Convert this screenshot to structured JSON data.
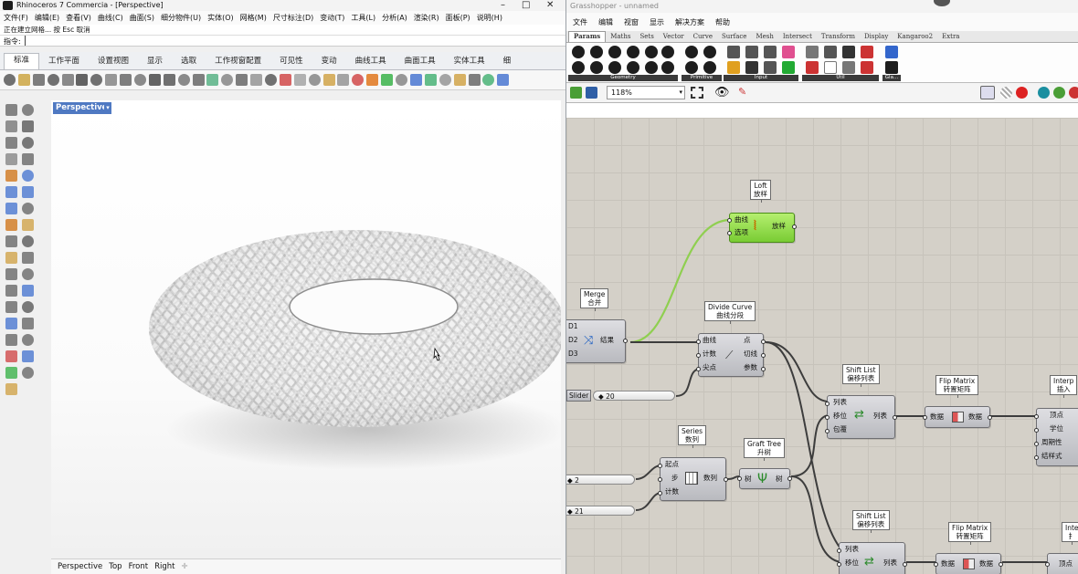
{
  "rhino": {
    "title": "Rhinoceros 7 Commercia - [Perspective]",
    "menu": [
      "文件(F)",
      "编辑(E)",
      "查看(V)",
      "曲线(C)",
      "曲面(S)",
      "细分物件(U)",
      "实体(O)",
      "网格(M)",
      "尺寸标注(D)",
      "变动(T)",
      "工具(L)",
      "分析(A)",
      "渲染(R)",
      "面板(P)",
      "说明(H)"
    ],
    "history_line": "正在建立网格... 按 Esc 取消",
    "command_label": "指令:",
    "tabs": [
      "标准",
      "工作平面",
      "设置视图",
      "显示",
      "选取",
      "工作视窗配置",
      "可见性",
      "变动",
      "曲线工具",
      "曲面工具",
      "实体工具",
      "细"
    ],
    "viewport_label": "Perspective",
    "viewport_tabs": [
      "Perspective",
      "Top",
      "Front",
      "Right"
    ],
    "add_view": "✛"
  },
  "gh": {
    "title": "Grasshopper - unnamed",
    "menu": [
      "文件",
      "编辑",
      "视窗",
      "显示",
      "解决方案",
      "帮助"
    ],
    "tabs": [
      "Params",
      "Maths",
      "Sets",
      "Vector",
      "Curve",
      "Surface",
      "Mesh",
      "Intersect",
      "Transform",
      "Display",
      "Kangaroo2",
      "Extra"
    ],
    "ribbon_groups": [
      "Geometry",
      "Primitive",
      "Input",
      "Util",
      "Gla..."
    ],
    "zoom": "118%",
    "nodes": {
      "loft": {
        "tag1": "Loft",
        "tag2": "放样",
        "in": [
          "曲线",
          "选项"
        ],
        "out": "放样"
      },
      "merge": {
        "tag1": "Merge",
        "tag2": "合并",
        "in": [
          "D1",
          "D2",
          "D3"
        ],
        "out": "结果"
      },
      "divide": {
        "tag1": "Divide Curve",
        "tag2": "曲线分段",
        "in": [
          "曲线",
          "计数",
          "尖点"
        ],
        "out": [
          "点",
          "切线",
          "参数"
        ]
      },
      "slider1": {
        "label": "Slider",
        "value": "◆ 20"
      },
      "shift1": {
        "tag1": "Shift List",
        "tag2": "偏移列表",
        "in": [
          "列表",
          "移位",
          "包覆"
        ],
        "out": "列表"
      },
      "flip1": {
        "tag1": "Flip Matrix",
        "tag2": "转置矩阵",
        "in": "数据",
        "out": "数据"
      },
      "interp1": {
        "tag1": "Interp",
        "tag2": "插入",
        "in": [
          "顶点",
          "学位",
          "周期性",
          "结样式"
        ]
      },
      "series": {
        "tag1": "Series",
        "tag2": "数列",
        "in": [
          "起点",
          "步",
          "计数"
        ],
        "out": "数列"
      },
      "graft": {
        "tag1": "Graft Tree",
        "tag2": "升树",
        "in": "树",
        "out": "树"
      },
      "num2": {
        "value": "◆ 2"
      },
      "num21": {
        "value": "◆ 21"
      },
      "shift2": {
        "tag1": "Shift List",
        "tag2": "偏移列表",
        "in": [
          "列表",
          "移位"
        ],
        "out": "列表"
      },
      "flip2": {
        "tag1": "Flip Matrix",
        "tag2": "转置矩阵",
        "in": "数据",
        "out": "数据"
      },
      "interp2": {
        "tag1": "Inte",
        "tag2": "扌",
        "in": "顶点"
      }
    }
  },
  "colors": {
    "viewport_label": "#4f79c2",
    "gh_canvas": "#d4d0c8",
    "loft_node": "#7fcf3a",
    "wire_selected": "#8fcf50"
  }
}
